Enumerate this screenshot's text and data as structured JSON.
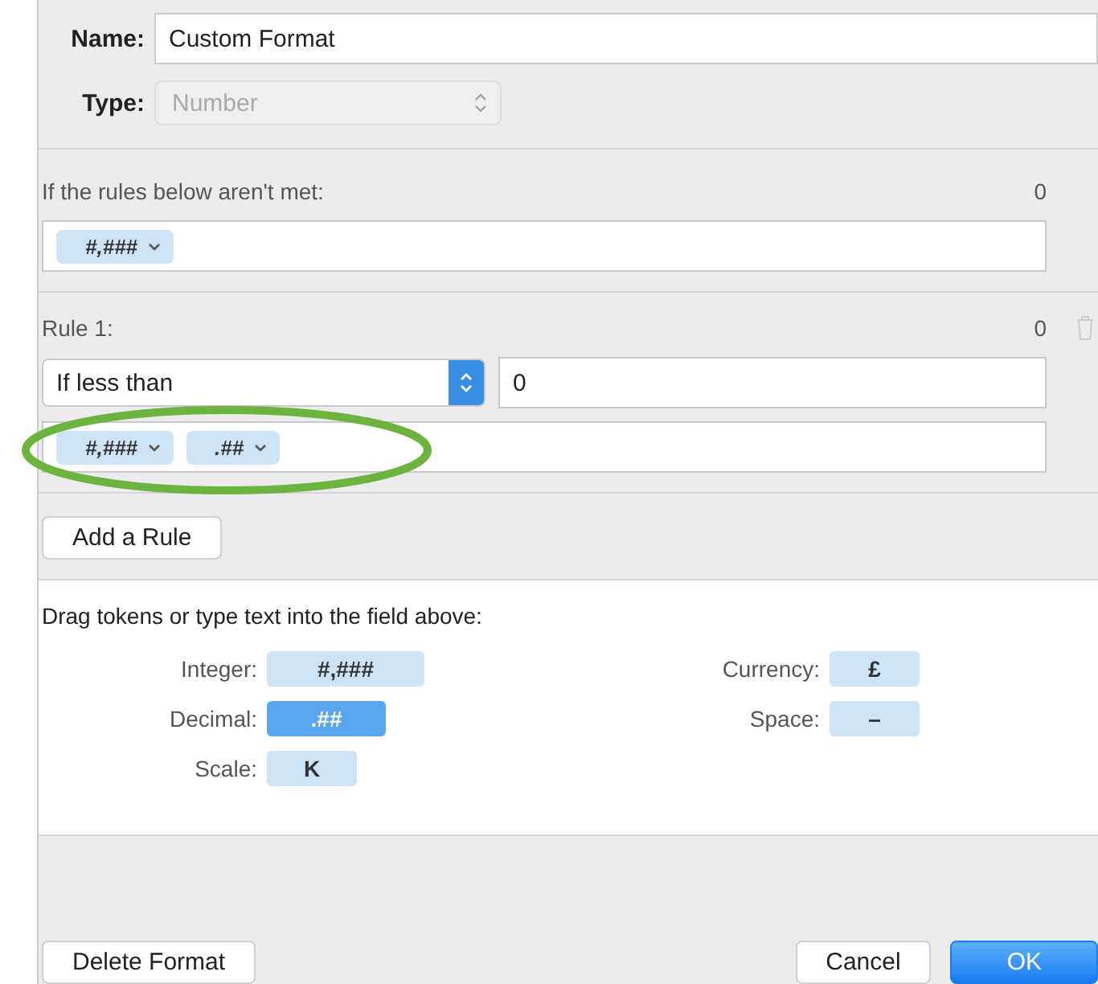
{
  "name_field": {
    "label": "Name:",
    "value": "Custom Format"
  },
  "type_field": {
    "label": "Type:",
    "value": "Number",
    "disabled": true
  },
  "default_rule": {
    "label": "If the rules below aren't met:",
    "count": "0",
    "tokens": [
      "#,###"
    ]
  },
  "rules": [
    {
      "label": "Rule 1:",
      "count": "0",
      "condition": "If less than",
      "value": "0",
      "tokens": [
        "#,###",
        ".##"
      ],
      "highlighted": true
    }
  ],
  "add_rule_button": "Add a Rule",
  "palette": {
    "hint": "Drag tokens or type text into the field above:",
    "left": [
      {
        "label": "Integer:",
        "token": "#,###",
        "selected": false
      },
      {
        "label": "Decimal:",
        "token": ".##",
        "selected": true
      },
      {
        "label": "Scale:",
        "token": "K",
        "selected": false
      }
    ],
    "right": [
      {
        "label": "Currency:",
        "token": "£",
        "selected": false
      },
      {
        "label": "Space:",
        "token": "–",
        "selected": false
      }
    ]
  },
  "buttons": {
    "delete": "Delete Format",
    "cancel": "Cancel",
    "ok": "OK"
  }
}
